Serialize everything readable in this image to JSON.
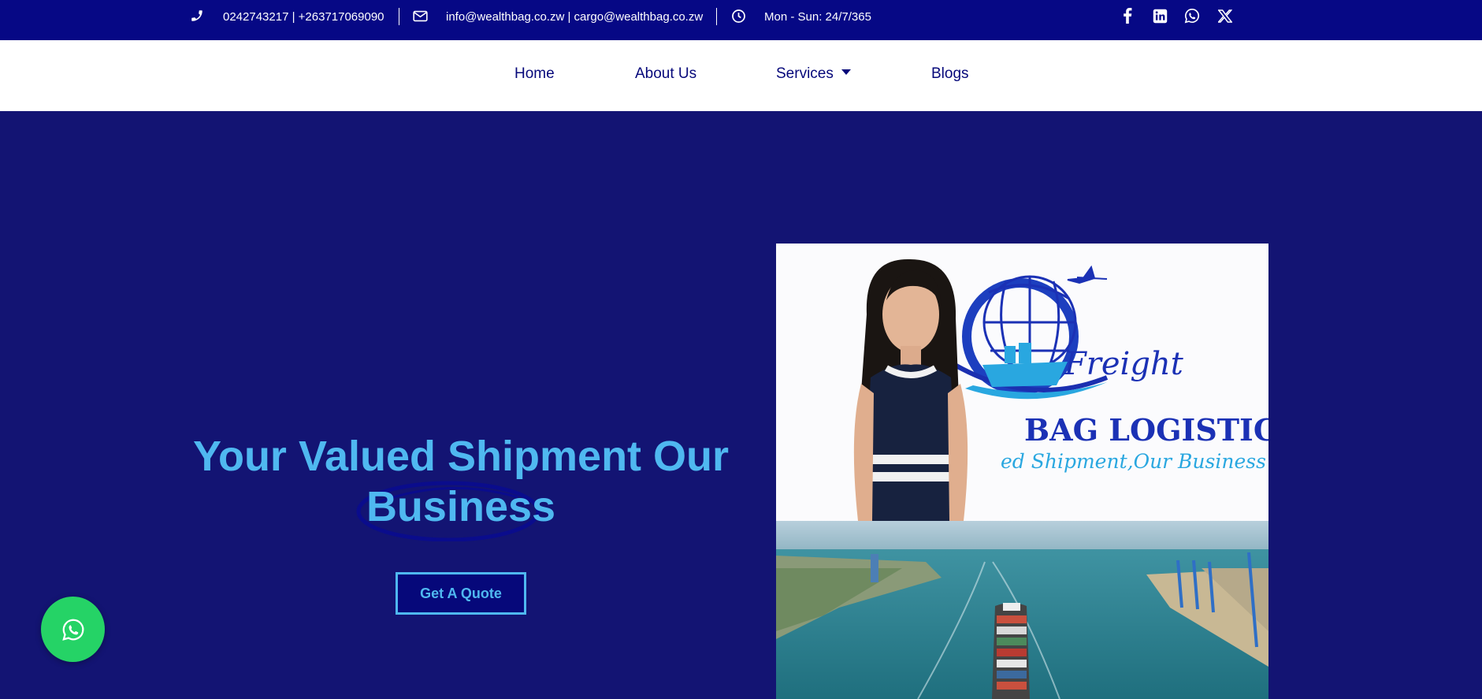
{
  "topbar": {
    "phone": "0242743217 | +263717069090",
    "email": "info@wealthbag.co.zw | cargo@wealthbag.co.zw",
    "hours": "Mon - Sun: 24/7/365",
    "icons": [
      "phone-icon",
      "envelope-icon",
      "clock-icon"
    ],
    "social": [
      "facebook-icon",
      "linkedin-icon",
      "whatsapp-icon",
      "x-icon"
    ]
  },
  "nav": {
    "items": [
      {
        "label": "Home"
      },
      {
        "label": "About Us"
      },
      {
        "label": "Services",
        "has_dropdown": true
      },
      {
        "label": "Blogs"
      }
    ]
  },
  "hero": {
    "title_line1": "Your Valued Shipment Our",
    "title_line2": "Business",
    "cta_label": "Get A Quote"
  },
  "video": {
    "logo_word": "Freight",
    "logo_name": "BAG LOGISTICS",
    "logo_tagline": "ed Shipment,Our Business"
  },
  "colors": {
    "topbar_bg": "#060885",
    "hero_bg": "#131473",
    "accent": "#4fb8f0",
    "whatsapp": "#25d366"
  }
}
